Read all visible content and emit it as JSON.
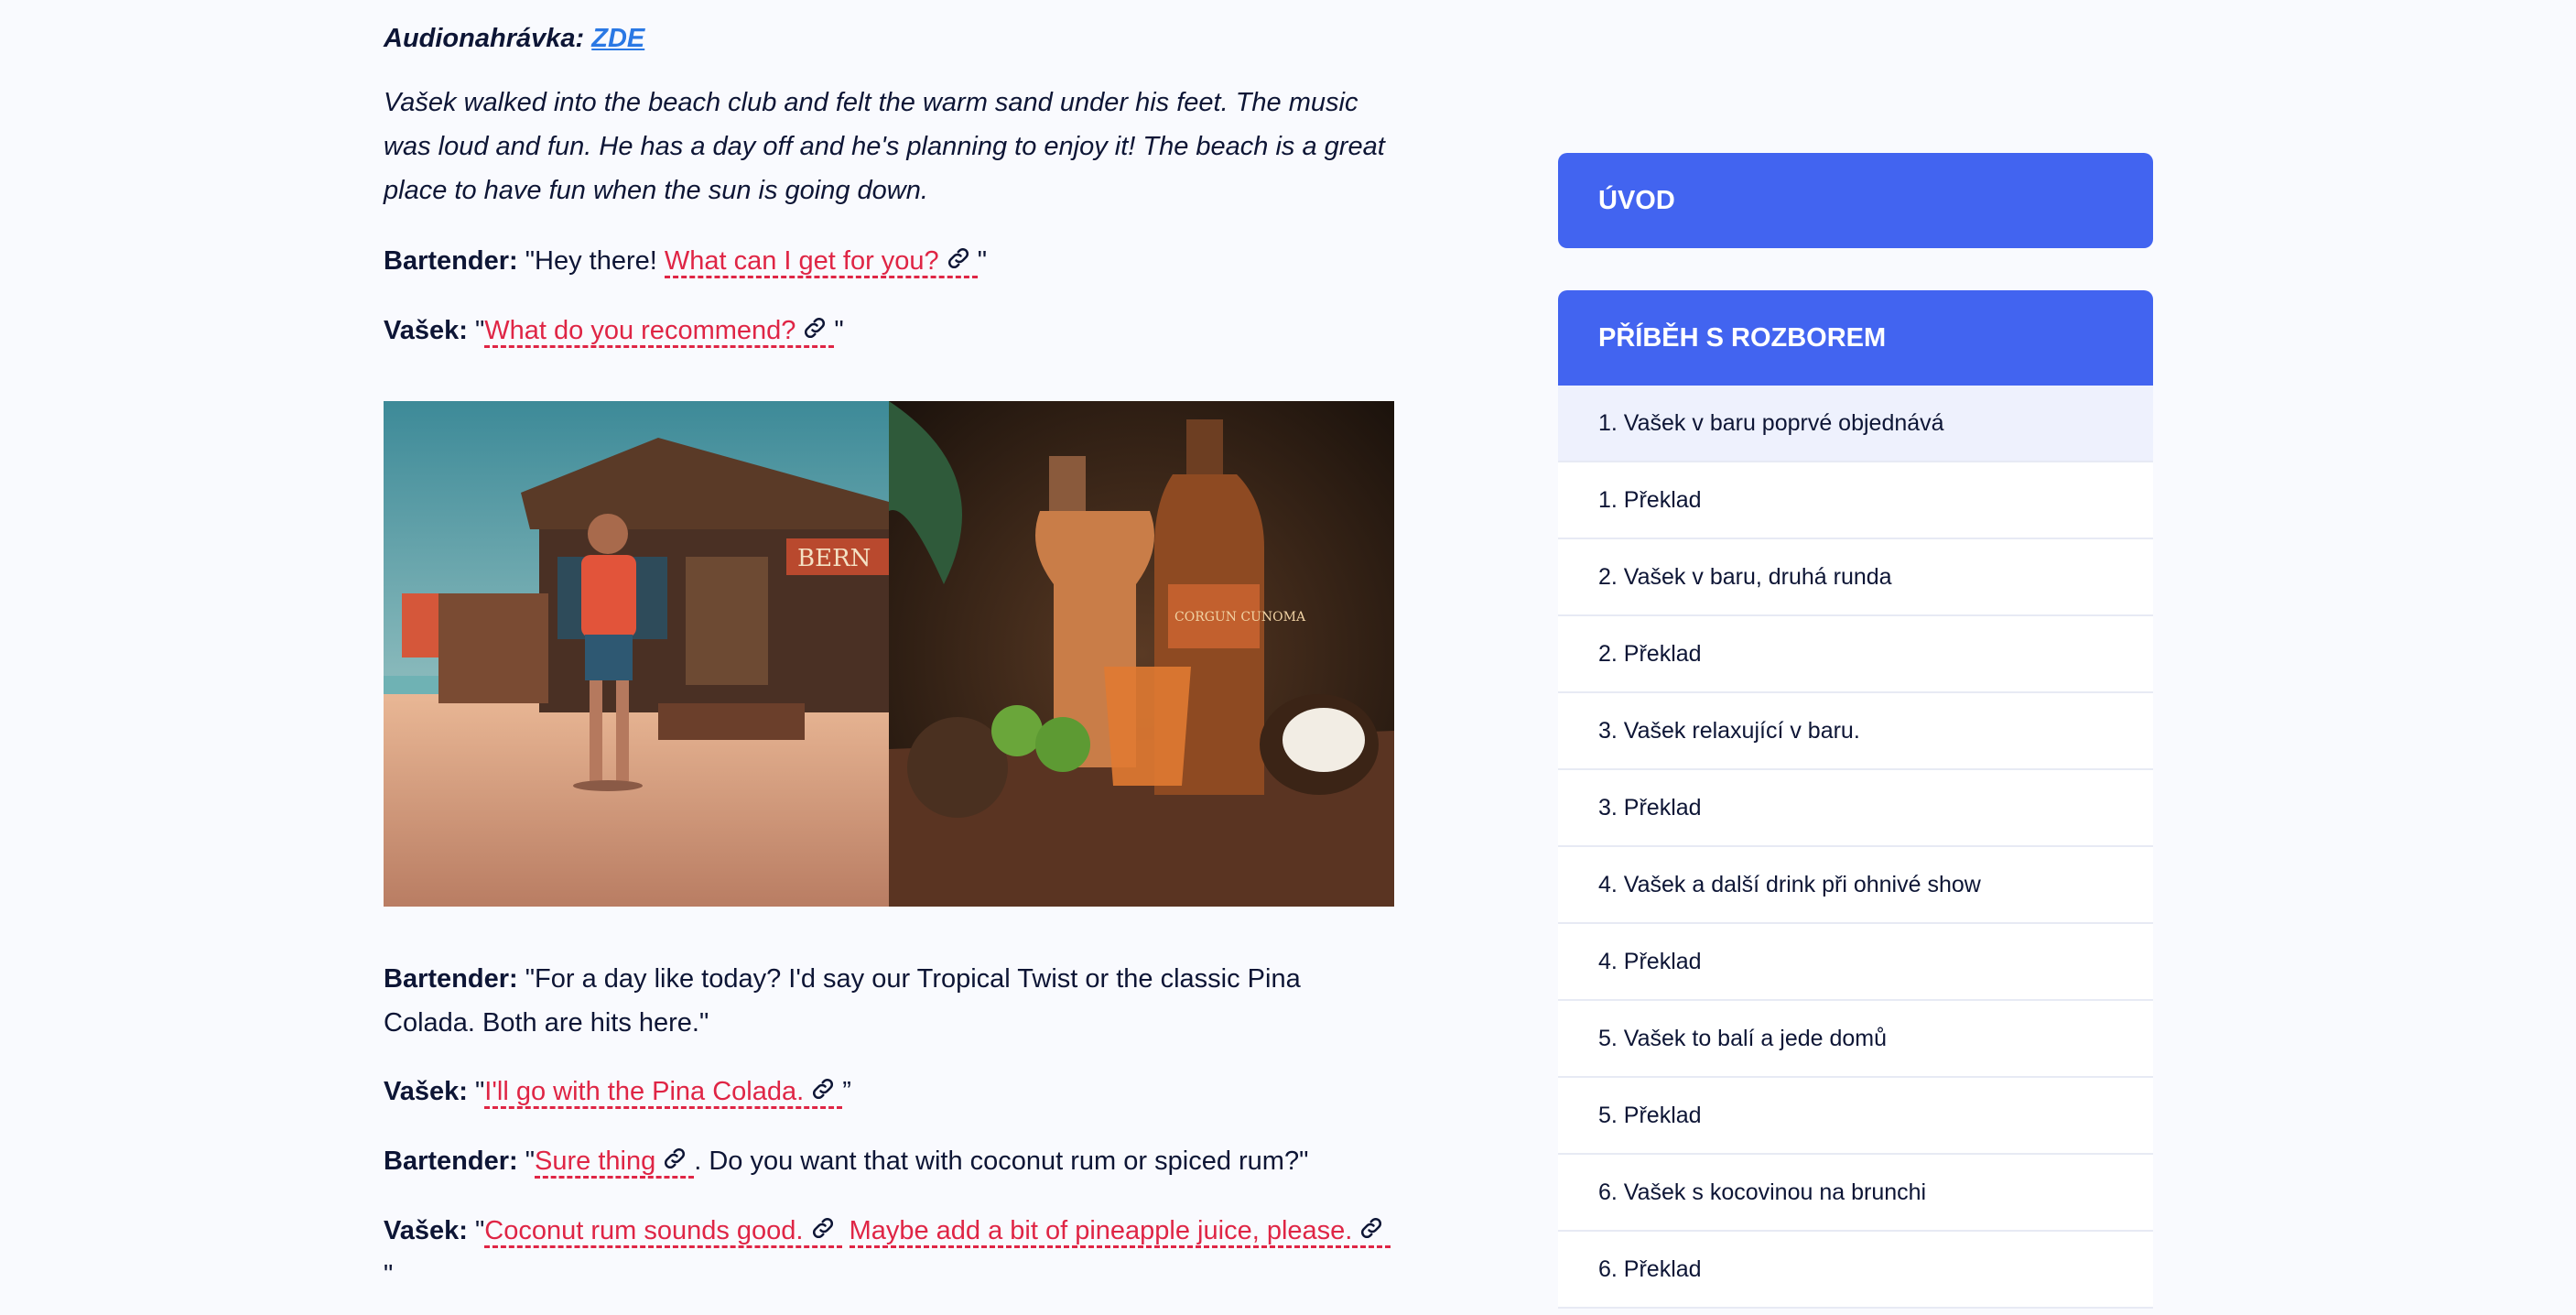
{
  "audio": {
    "label": "Audionahrávka:",
    "link": "ZDE"
  },
  "intro": "Vašek walked into the beach club and felt the warm sand under his feet. The music was loud and fun. He has a day off and he's planning to enjoy it! The beach is a great place to have fun when the sun is going down.",
  "dialogue": {
    "l1": {
      "speaker": "Bartender:",
      "pre": " \"Hey there! ",
      "phrase": "What can I get for you?",
      "post": "\""
    },
    "l2": {
      "speaker": "Vašek:",
      "pre": " \"",
      "phrase": "What do you recommend?",
      "post": "\""
    },
    "l3": {
      "speaker": "Bartender:",
      "text": " \"For a day like today? I'd say our Tropical Twist or the classic Pina Colada. Both are hits here.\""
    },
    "l4": {
      "speaker": "Vašek:",
      "pre": " \"",
      "phrase": "I'll go with the Pina Colada.",
      "post": "”"
    },
    "l5": {
      "speaker": "Bartender:",
      "pre": " \"",
      "phrase": "Sure thing",
      "post": ". Do you want that with coconut rum or spiced rum?\""
    },
    "l6": {
      "speaker": "Vašek:",
      "pre": " \"",
      "phrase1": "Coconut rum sounds good.",
      "phrase2": "Maybe add a bit of pineapple juice, please.",
      "post": "\""
    }
  },
  "image_text": {
    "sign": "BERN",
    "bottle_label": "CORGUN CUNOMA"
  },
  "sidebar": {
    "uvod": "ÚVOD",
    "pribeh": "PŘÍBĚH S ROZBOREM",
    "items": [
      "1. Vašek v baru poprvé objednává",
      "1. Překlad",
      "2. Vašek v baru, druhá runda",
      "2. Překlad",
      "3. Vašek relaxující v baru.",
      "3. Překlad",
      "4. Vašek a další drink při ohnivé show",
      "4. Překlad",
      "5. Vašek to balí a jede domů",
      "5. Překlad",
      "6. Vašek s kocovinou na brunchi",
      "6. Překlad"
    ]
  },
  "colors": {
    "accent": "#4264f0",
    "phrase": "#df2545",
    "link": "#2a78e4",
    "text": "#0d1535",
    "background": "#f9fafe"
  },
  "icons": {
    "phrase_link": "link-icon"
  }
}
